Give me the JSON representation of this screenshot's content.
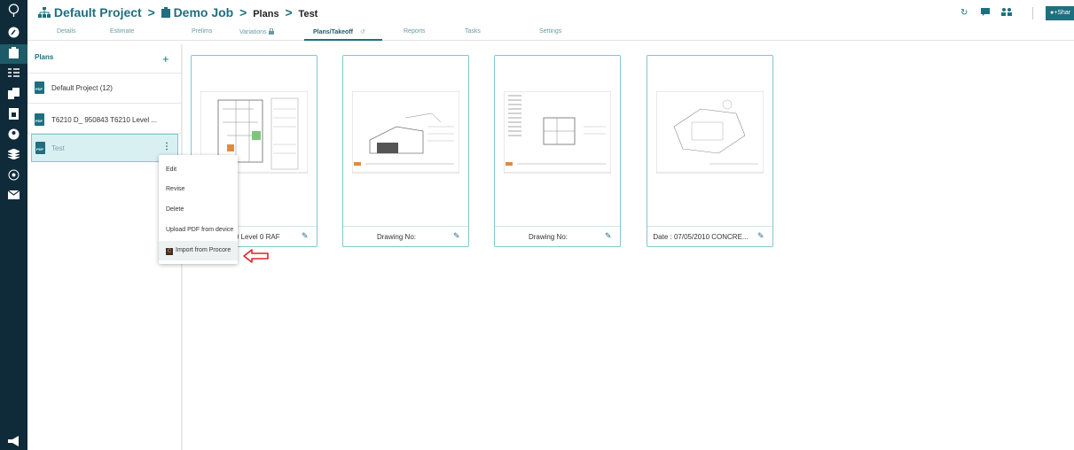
{
  "breadcrumb": {
    "project": "Default Project",
    "job": "Demo Job",
    "section": "Plans",
    "item": "Test",
    "separator": ">"
  },
  "tabs": [
    "Details",
    "Estimate",
    "Prelims",
    "Variations",
    "Plans/Takeoff",
    "Reports",
    "Tasks",
    "Settings"
  ],
  "active_tab": "Plans/Takeoff",
  "share_label": "Shar",
  "plans_panel": {
    "title": "Plans",
    "add_label": "+",
    "items": [
      {
        "label": "Default Project (12)"
      },
      {
        "label": "T6210 D_ 950843 T6210 Level ..."
      },
      {
        "label": "Test"
      }
    ]
  },
  "context_menu": {
    "items": [
      "Edit",
      "Revise",
      "Delete",
      "Upload PDF from device",
      "Import from Procore"
    ]
  },
  "cards": [
    {
      "caption": "210 Level 0 RAF"
    },
    {
      "caption": "Drawing No:"
    },
    {
      "caption": "Drawing No:"
    },
    {
      "caption": "Date : 07/05/2010 CONCRE..."
    }
  ],
  "pdf_badge": "PDF",
  "procore_icon_letter": "C",
  "colors": {
    "sidebar": "#0f2b3a",
    "accent": "#1e6f80",
    "selected_bg": "#d9f0f2",
    "annotation_arrow": "#e0232a"
  }
}
